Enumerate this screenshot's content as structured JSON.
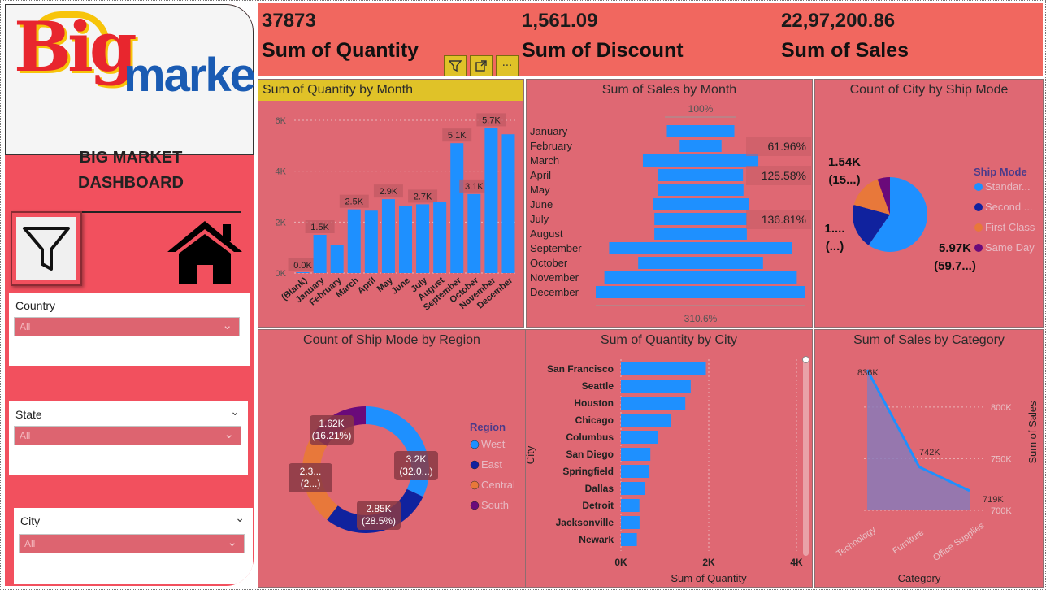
{
  "sidebar": {
    "logo": {
      "big": "Big",
      "market": "market"
    },
    "title_line1": "BIG MARKET",
    "title_line2": "DASHBOARD",
    "slicers": [
      {
        "label": "Country",
        "value": "All"
      },
      {
        "label": "State",
        "value": "All"
      },
      {
        "label": "City",
        "value": "All"
      }
    ]
  },
  "kpis": [
    {
      "value": "37873",
      "label": "Sum of Quantity"
    },
    {
      "value": "1,561.09",
      "label": "Sum of Discount"
    },
    {
      "value": "22,97,200.86",
      "label": "Sum of Sales"
    }
  ],
  "toolbar": {
    "filter_icon": "filter-icon",
    "focus_icon": "focus-mode-icon",
    "more_label": "···"
  },
  "colors": {
    "bar": "#1e90ff",
    "panel": "#df6873",
    "kpi": "#f1675f",
    "highlight": "#e0c228",
    "dark_blue": "#10229e",
    "orange": "#e8783a",
    "purple": "#6a0a7a"
  },
  "chart_data": [
    {
      "type": "bar",
      "title": "Sum of Quantity by Month",
      "categories": [
        "(Blank)",
        "January",
        "February",
        "March",
        "April",
        "May",
        "June",
        "July",
        "August",
        "September",
        "October",
        "November",
        "December"
      ],
      "values": [
        0,
        1500,
        1100,
        2500,
        2450,
        2900,
        2650,
        2700,
        2800,
        5100,
        3100,
        5700,
        5450
      ],
      "data_labels": {
        "(Blank)": "0.0K",
        "January": "1.5K",
        "March": "2.5K",
        "May": "2.9K",
        "July": "2.7K",
        "September": "5.1K",
        "October": "3.1K",
        "November": "5.7K"
      },
      "ylim": [
        0,
        6000
      ],
      "yticks": [
        "0K",
        "2K",
        "4K",
        "6K"
      ],
      "grid": true
    },
    {
      "type": "bar",
      "title": "Sum of Sales by Month",
      "orientation": "horizontal-funnel",
      "categories": [
        "January",
        "February",
        "March",
        "April",
        "May",
        "June",
        "July",
        "August",
        "September",
        "October",
        "November",
        "December"
      ],
      "values": [
        100,
        61.96,
        171,
        125.58,
        127,
        142,
        136.81,
        137,
        271,
        185,
        285,
        310.6
      ],
      "top_label": "100%",
      "bottom_label": "310.6%",
      "callouts": [
        "61.96%",
        "125.58%",
        "136.81%"
      ]
    },
    {
      "type": "pie",
      "title": "Count of City by Ship Mode",
      "legend_title": "Ship Mode",
      "legend_position": "right",
      "slices": [
        {
          "name": "Standar...",
          "value": 59.7,
          "label": "5.97K",
          "label2": "(59.7...)"
        },
        {
          "name": "Second ...",
          "value": 19.5,
          "label": "1....",
          "label2": "(...)"
        },
        {
          "name": "First Class",
          "value": 15.4,
          "label": "1.54K",
          "label2": "(15...)"
        },
        {
          "name": "Same Day",
          "value": 5.4,
          "label": "",
          "label2": ""
        }
      ]
    },
    {
      "type": "pie",
      "subtype": "donut",
      "title": "Count of Ship Mode by Region",
      "legend_title": "Region",
      "legend_position": "right",
      "slices": [
        {
          "name": "West",
          "value": 32.0,
          "label": "3.2K",
          "label2": "(32.0...)"
        },
        {
          "name": "East",
          "value": 28.5,
          "label": "2.85K",
          "label2": "(28.5%)"
        },
        {
          "name": "Central",
          "value": 23.29,
          "label": "2.3...",
          "label2": "(2...)"
        },
        {
          "name": "South",
          "value": 16.21,
          "label": "1.62K",
          "label2": "(16.21%)"
        }
      ]
    },
    {
      "type": "bar",
      "orientation": "horizontal",
      "title": "Sum of Quantity by City",
      "xlabel": "Sum of Quantity",
      "ylabel": "City",
      "categories": [
        "San Francisco",
        "Seattle",
        "Houston",
        "Chicago",
        "Columbus",
        "San Diego",
        "Springfield",
        "Dallas",
        "Detroit",
        "Jacksonville",
        "Newark"
      ],
      "values": [
        1935,
        1590,
        1466,
        1132,
        836,
        670,
        649,
        550,
        420,
        424,
        363
      ],
      "xlim": [
        0,
        4000
      ],
      "xticks": [
        "0K",
        "2K",
        "4K"
      ]
    },
    {
      "type": "area",
      "title": "Sum of Sales by Category",
      "xlabel": "Category",
      "ylabel": "Sum of Sales",
      "categories": [
        "Technology",
        "Furniture",
        "Office Supplies"
      ],
      "values": [
        836000,
        742000,
        719000
      ],
      "data_labels": [
        "836K",
        "742K",
        "719K"
      ],
      "ylim": [
        700000,
        840000
      ],
      "yticks": [
        "700K",
        "750K",
        "800K"
      ]
    }
  ]
}
